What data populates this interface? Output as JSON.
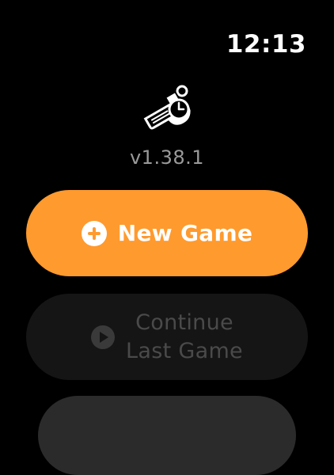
{
  "status": {
    "time": "12:13"
  },
  "app": {
    "icon": "whistle-with-clock-icon",
    "version": "v1.38.1"
  },
  "buttons": {
    "new_game": {
      "label": "New Game",
      "icon": "plus-circle-icon",
      "color": "#ff9a2e"
    },
    "continue": {
      "line1": "Continue",
      "line2": "Last Game",
      "icon": "play-circle-icon",
      "enabled": false
    }
  }
}
